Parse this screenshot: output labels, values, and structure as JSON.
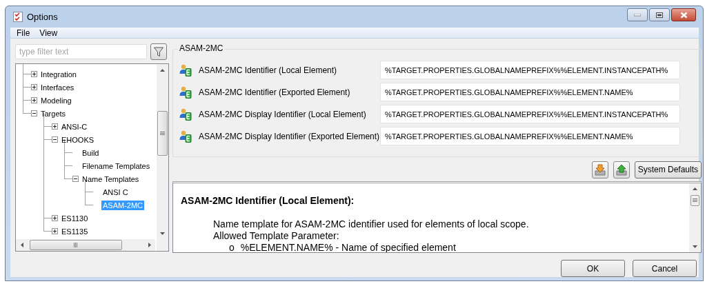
{
  "window": {
    "title": "Options"
  },
  "menu": [
    "File",
    "View"
  ],
  "filter": {
    "placeholder": "type filter text"
  },
  "tree": [
    {
      "label": "Integration",
      "expanded": false,
      "selected": false
    },
    {
      "label": "Interfaces",
      "expanded": false,
      "selected": false
    },
    {
      "label": "Modeling",
      "expanded": false,
      "selected": false
    },
    {
      "label": "Targets",
      "expanded": true,
      "selected": false,
      "children": [
        {
          "label": "ANSI-C",
          "expanded": false,
          "selected": false
        },
        {
          "label": "EHOOKS",
          "expanded": true,
          "selected": false,
          "children": [
            {
              "label": "Build",
              "selected": false
            },
            {
              "label": "Filename Templates",
              "selected": false
            },
            {
              "label": "Name Templates",
              "expanded": true,
              "selected": false,
              "children": [
                {
                  "label": "ANSI C",
                  "selected": false
                },
                {
                  "label": "ASAM-2MC",
                  "selected": true
                }
              ]
            }
          ]
        },
        {
          "label": "ES1130",
          "expanded": false,
          "selected": false
        },
        {
          "label": "ES1135",
          "expanded": false,
          "selected": false
        }
      ]
    }
  ],
  "section": {
    "title": "ASAM-2MC",
    "rows": [
      {
        "label": "ASAM-2MC Identifier (Local Element)",
        "value": "%TARGET.PROPERTIES.GLOBALNAMEPREFIX%%ELEMENT.INSTANCEPATH%"
      },
      {
        "label": "ASAM-2MC Identifier (Exported Element)",
        "value": "%TARGET.PROPERTIES.GLOBALNAMEPREFIX%%ELEMENT.NAME%"
      },
      {
        "label": "ASAM-2MC Display Identifier (Local Element)",
        "value": "%TARGET.PROPERTIES.GLOBALNAMEPREFIX%%ELEMENT.INSTANCEPATH%"
      },
      {
        "label": "ASAM-2MC Display Identifier (Exported Element)",
        "value": "%TARGET.PROPERTIES.GLOBALNAMEPREFIX%%ELEMENT.NAME%"
      }
    ]
  },
  "system_defaults": "System Defaults",
  "description": {
    "heading": "ASAM-2MC Identifier (Local Element):",
    "lines": [
      "Name template for ASAM-2MC identifier used for elements of local scope.",
      "Allowed Template Parameter:"
    ],
    "bullets": [
      {
        "marker": "o",
        "text": "%ELEMENT.NAME% - Name of specified element"
      }
    ]
  },
  "buttons": [
    "OK",
    "Cancel"
  ]
}
